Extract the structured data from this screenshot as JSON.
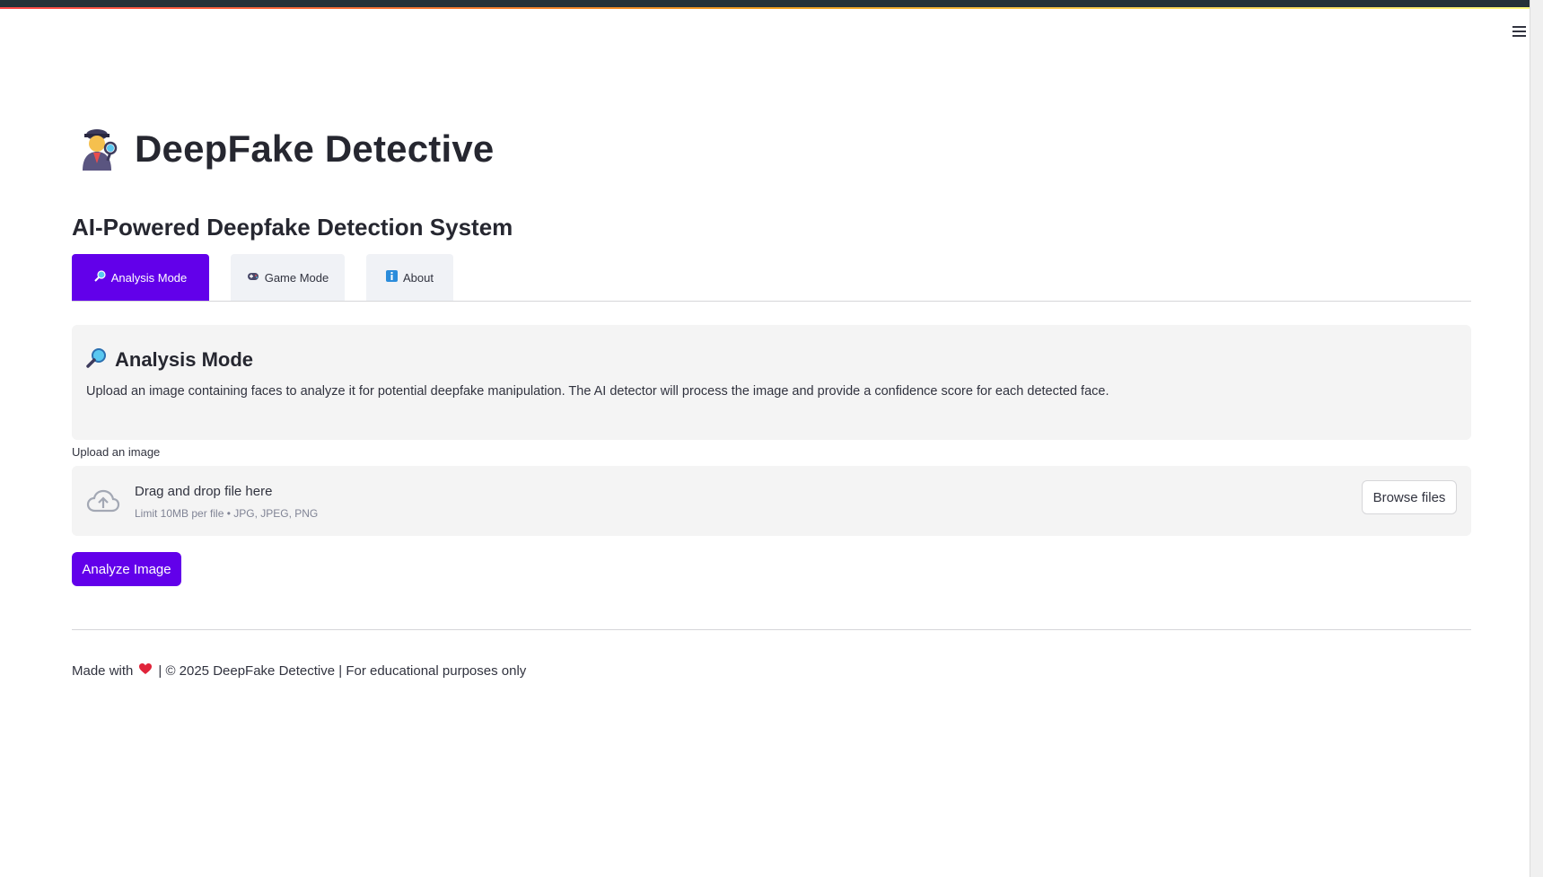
{
  "app": {
    "title": "DeepFake Detective",
    "title_icon": "detective-icon",
    "subtitle": "AI-Powered Deepfake Detection System"
  },
  "tabs": [
    {
      "label": "Analysis Mode",
      "icon": "magnifier-icon",
      "active": true
    },
    {
      "label": "Game Mode",
      "icon": "gamepad-icon",
      "active": false
    },
    {
      "label": "About",
      "icon": "info-icon",
      "active": false
    }
  ],
  "info": {
    "title": "Analysis Mode",
    "icon": "magnifier-icon",
    "description": "Upload an image containing faces to analyze it for potential deepfake manipulation. The AI detector will process the image and provide a confidence score for each detected face."
  },
  "uploader": {
    "label": "Upload an image",
    "drop_text": "Drag and drop file here",
    "limit_text": "Limit 10MB per file • JPG, JPEG, PNG",
    "browse_label": "Browse files"
  },
  "actions": {
    "analyze_label": "Analyze Image"
  },
  "footer": {
    "prefix": "Made with",
    "suffix": "| © 2025 DeepFake Detective | For educational purposes only"
  },
  "colors": {
    "accent": "#6200ea",
    "heart": "#e0243a"
  }
}
